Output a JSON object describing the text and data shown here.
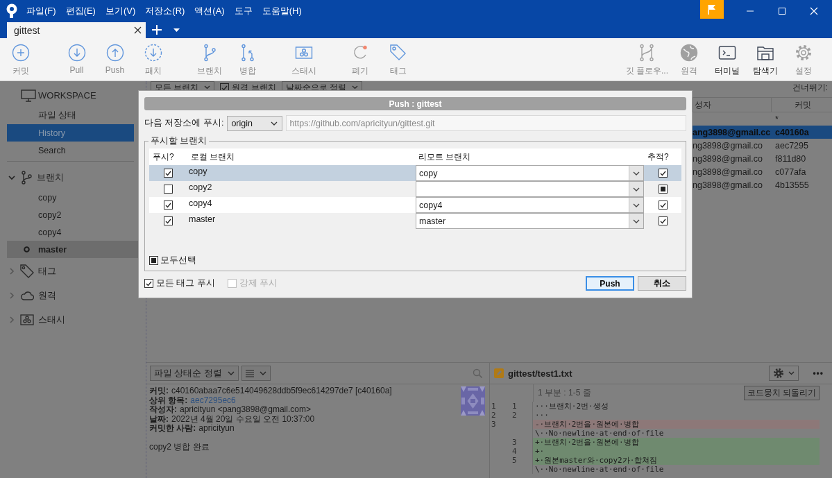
{
  "window": {
    "menu": [
      "파일(F)",
      "편집(E)",
      "보기(V)",
      "저장소(R)",
      "액션(A)",
      "도구",
      "도움말(H)"
    ]
  },
  "tabs": [
    {
      "label": "gittest",
      "selected": true
    }
  ],
  "toolbar": {
    "groups": [
      {
        "items": [
          {
            "label": "커밋",
            "kind": "commit",
            "active": false
          }
        ]
      },
      {
        "items": [
          {
            "label": "Pull",
            "kind": "pull",
            "active": false
          },
          {
            "label": "Push",
            "kind": "push",
            "active": false
          },
          {
            "label": "패치",
            "kind": "fetch",
            "active": false
          }
        ]
      },
      {
        "items": [
          {
            "label": "브랜치",
            "kind": "branch",
            "active": false
          },
          {
            "label": "병합",
            "kind": "merge",
            "active": false
          }
        ]
      },
      {
        "items": [
          {
            "label": "스태시",
            "kind": "stash",
            "active": false
          }
        ]
      },
      {
        "items": [
          {
            "label": "폐기",
            "kind": "discard",
            "active": false
          },
          {
            "label": "태그",
            "kind": "tag",
            "active": false
          }
        ]
      }
    ],
    "right_items": [
      {
        "label": "깃 플로우...",
        "kind": "gitflow",
        "active": false
      },
      {
        "label": "원격",
        "kind": "remote",
        "active": false
      },
      {
        "label": "터미널",
        "kind": "terminal",
        "active": true
      },
      {
        "label": "탐색기",
        "kind": "explorer",
        "active": true
      },
      {
        "label": "설정",
        "kind": "settings",
        "active": false
      }
    ]
  },
  "sidebar": {
    "workspace": {
      "title": "WORKSPACE",
      "items": [
        {
          "label": "파일 상태",
          "selected": false
        },
        {
          "label": "History",
          "selected": true
        },
        {
          "label": "Search",
          "selected": false
        }
      ]
    },
    "groups": [
      {
        "kind": "branch",
        "label": "브랜치",
        "expanded": true,
        "children": [
          {
            "label": "copy",
            "current": false
          },
          {
            "label": "copy2",
            "current": false
          },
          {
            "label": "copy4",
            "current": false
          },
          {
            "label": "master",
            "current": true
          }
        ]
      },
      {
        "kind": "tag",
        "label": "태그",
        "expanded": false
      },
      {
        "kind": "remote",
        "label": "원격",
        "expanded": false
      },
      {
        "kind": "stash",
        "label": "스태시",
        "expanded": false
      }
    ]
  },
  "history": {
    "filters": [
      {
        "kind": "dropdown",
        "label": "모든 브랜치"
      },
      {
        "kind": "checkbox",
        "label": "원격 브랜치",
        "checked": true
      },
      {
        "kind": "dropdown",
        "label": "날짜순으로 정렬"
      }
    ],
    "skip_label": "건너뛰기:",
    "columns": [
      "성자",
      "커밋"
    ],
    "rows": [
      {
        "commit": "*",
        "selected": false
      },
      {
        "author": "ang3898@gmail.cc",
        "commit": "c40160a",
        "selected": true
      },
      {
        "author": "ng3898@gmail.co",
        "commit": "aec7295",
        "selected": false
      },
      {
        "author": "ng3898@gmail.co",
        "commit": "f811d80",
        "selected": false
      },
      {
        "author": "ng3898@gmail.co",
        "commit": "c077afa",
        "selected": false
      },
      {
        "author": "ng3898@gmail.co",
        "commit": "4b13555",
        "selected": false
      }
    ]
  },
  "push_dialog": {
    "title": "Push : gittest",
    "remote_label": "다음 저장소에 푸시:",
    "remote": "origin",
    "url": "https://github.com/apricityun/gittest.git",
    "branches_label": "푸시할 브랜치",
    "columns": [
      "푸시?",
      "로컬 브랜치",
      "리모트 브랜치",
      "추적?"
    ],
    "branches": [
      {
        "local": "copy",
        "remote": "copy",
        "push": true,
        "tracked": true,
        "mixed": false,
        "selected": true
      },
      {
        "local": "copy2",
        "push": false,
        "tracked": false,
        "mixed": true,
        "selected": false
      },
      {
        "local": "copy4",
        "remote": "copy4",
        "push": true,
        "tracked": true,
        "mixed": false,
        "selected": false
      },
      {
        "local": "master",
        "remote": "master",
        "push": true,
        "tracked": true,
        "mixed": false,
        "selected": false
      }
    ],
    "select_all": {
      "label": "모두선택",
      "checked": false,
      "mixed": true
    },
    "options": [
      {
        "label": "모든 태그 푸시",
        "checked": true,
        "disabled": false
      },
      {
        "label": "강제 푸시",
        "checked": false,
        "disabled": true
      }
    ],
    "buttons": [
      {
        "label": "Push",
        "default": true
      },
      {
        "label": "취소",
        "default": false
      }
    ]
  },
  "details": {
    "sort": "파일 상태순 정렬",
    "fields": [
      {
        "label": "커밋:",
        "value": "c40160abaa7c6e514049628ddb5f9ec614297de7 [c40160a]",
        "kind": "text"
      },
      {
        "label": "상위 항목:",
        "value": "aec7295ec6",
        "kind": "link"
      },
      {
        "label": "작성자:",
        "value": "apricityun <pang3898@gmail.com>",
        "kind": "text"
      },
      {
        "label": "날짜:",
        "value": "2022년 4월 20일 수요일 오전 10:37:00",
        "kind": "text"
      },
      {
        "label": "커밋한 사람:",
        "value": "apricityun",
        "kind": "text"
      }
    ],
    "message": "copy2 병합 완료"
  },
  "diff": {
    "file": "gittest/test1.txt",
    "more": "•••",
    "hunk": "1 부분 : 1-5 줄",
    "revert": "코드뭉치 되돌리기",
    "lines": [
      {
        "old": "1",
        "new": "1",
        "kind": "context",
        "text": "···브랜치·2번·생성"
      },
      {
        "old": "2",
        "new": "2",
        "kind": "context",
        "text": "···"
      },
      {
        "old": "3",
        "kind": "removed",
        "text": "-·브랜치·2번을·원본에·병합"
      },
      {
        "kind": "context",
        "text": "\\··No·newline·at·end·of·file"
      },
      {
        "new": "3",
        "kind": "added",
        "text": "+·브랜치·2번을·원본에·병합"
      },
      {
        "new": "4",
        "kind": "added",
        "text": "+·"
      },
      {
        "new": "5",
        "kind": "added",
        "text": "+·원본master와·copy2가·합쳐짐"
      },
      {
        "kind": "context",
        "text": "\\··No·newline·at·end·of·file"
      }
    ]
  }
}
